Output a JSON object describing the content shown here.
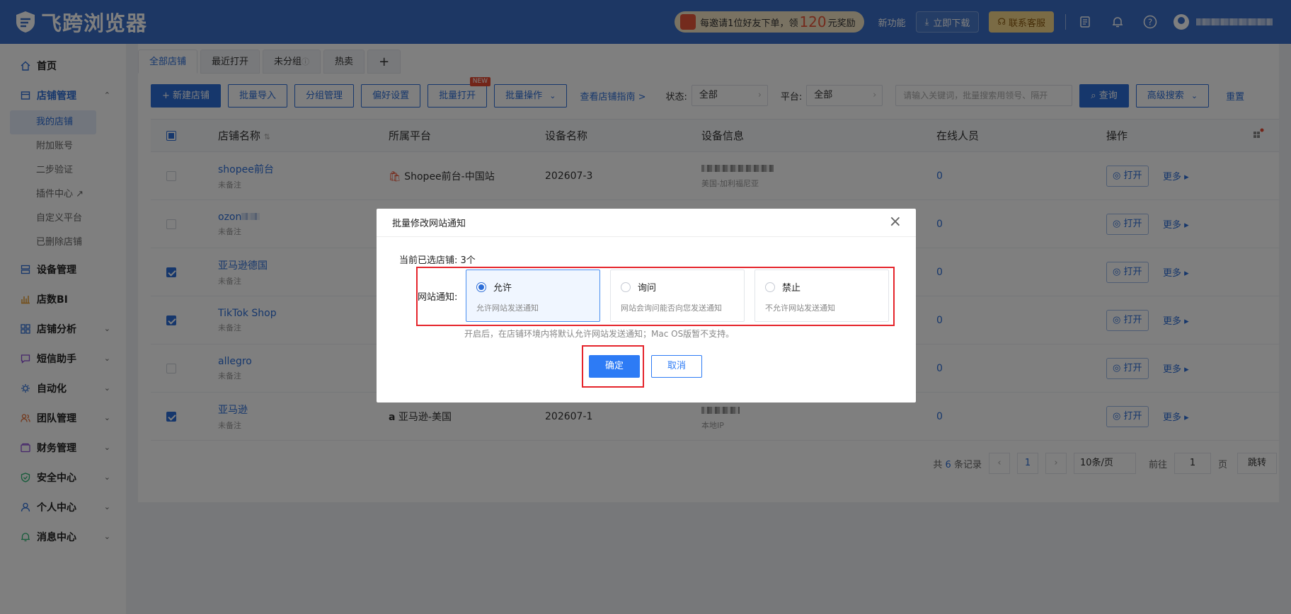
{
  "app": {
    "title": "飞跨浏览器"
  },
  "topbar": {
    "promo_prefix": "每邀请1位好友下单，领",
    "promo_amount": "120",
    "promo_suffix": "元奖励",
    "new_features": "新功能",
    "download": "立即下载",
    "support": "联系客服"
  },
  "sidebar": {
    "items": [
      {
        "label": "首页",
        "icon": "home-icon"
      },
      {
        "label": "店铺管理",
        "icon": "store-icon",
        "expanded": true,
        "children": [
          "我的店铺",
          "附加账号",
          "二步验证",
          "插件中心",
          "自定义平台",
          "已删除店铺"
        ]
      },
      {
        "label": "设备管理",
        "icon": "device-icon"
      },
      {
        "label": "店数BI",
        "icon": "bi-chart-icon"
      },
      {
        "label": "店铺分析",
        "icon": "grid-icon"
      },
      {
        "label": "短信助手",
        "icon": "message-icon"
      },
      {
        "label": "自动化",
        "icon": "automation-icon"
      },
      {
        "label": "团队管理",
        "icon": "team-icon"
      },
      {
        "label": "财务管理",
        "icon": "wallet-icon"
      },
      {
        "label": "安全中心",
        "icon": "shield-icon"
      },
      {
        "label": "个人中心",
        "icon": "user-icon"
      },
      {
        "label": "消息中心",
        "icon": "bell-icon"
      }
    ]
  },
  "tabs": [
    "全部店铺",
    "最近打开",
    "未分组",
    "热卖",
    "+"
  ],
  "toolbar": {
    "new_store": "+ 新建店铺",
    "batch_import": "批量导入",
    "group_manage": "分组管理",
    "preferences": "偏好设置",
    "batch_open": "批量打开",
    "new_tag": "NEW",
    "batch_ops": "批量操作",
    "guide_link": "查看店铺指南 >",
    "status_label": "状态:",
    "status_value": "全部",
    "platform_label": "平台:",
    "platform_value": "全部",
    "search_placeholder": "请输入关键词，批量搜索用领号、隔开",
    "search_btn": "查询",
    "advanced": "高级搜索",
    "reset": "重置"
  },
  "table": {
    "headers": [
      "店铺名称",
      "所属平台",
      "设备名称",
      "设备信息",
      "在线人员",
      "操作"
    ],
    "rows": [
      {
        "name": "shopee前台",
        "note": "未备注",
        "platform": "Shopee前台-中国站",
        "device": "202607-3",
        "devinfo_sub": "美国-加利福尼亚",
        "online": "0",
        "checked": false
      },
      {
        "name": "ozon",
        "note": "未备注",
        "platform": "",
        "device": "",
        "devinfo_sub": "",
        "online": "0",
        "checked": false
      },
      {
        "name": "亚马逊德国",
        "note": "未备注",
        "platform": "",
        "device": "",
        "devinfo_sub": "",
        "online": "0",
        "checked": true
      },
      {
        "name": "TikTok Shop",
        "note": "未备注",
        "platform": "",
        "device": "",
        "devinfo_sub": "",
        "online": "0",
        "checked": true
      },
      {
        "name": "allegro",
        "note": "未备注",
        "platform": "",
        "device": "",
        "devinfo_sub": "",
        "online": "0",
        "checked": false
      },
      {
        "name": "亚马逊",
        "note": "未备注",
        "platform": "亚马逊-美国",
        "device": "202607-1",
        "devinfo_sub": "本地IP",
        "online": "0",
        "checked": true
      }
    ],
    "open_label": "打开",
    "more_label": "更多"
  },
  "pager": {
    "total_prefix": "共",
    "total": "6",
    "total_suffix": "条记录",
    "current": "1",
    "page_size": "10条/页",
    "goto_label": "前往",
    "goto_value": "1",
    "page_label": "页",
    "jump": "跳转"
  },
  "modal": {
    "title": "批量修改网站通知",
    "selected_label": "当前已选店铺:",
    "selected_count": "3个",
    "notify_label": "网站通知:",
    "options": [
      {
        "title": "允许",
        "desc": "允许网站发送通知",
        "selected": true
      },
      {
        "title": "询问",
        "desc": "网站会询问能否向您发送通知",
        "selected": false
      },
      {
        "title": "禁止",
        "desc": "不允许网站发送通知",
        "selected": false
      }
    ],
    "hint": "开启后，在店铺环境内将默认允许网站发送通知；Mac OS版暂不支持。",
    "confirm": "确定",
    "cancel": "取消"
  },
  "colors": {
    "topbar": "#3a6fc9",
    "primary": "#2d6ed8",
    "highlight": "#e5242b"
  }
}
